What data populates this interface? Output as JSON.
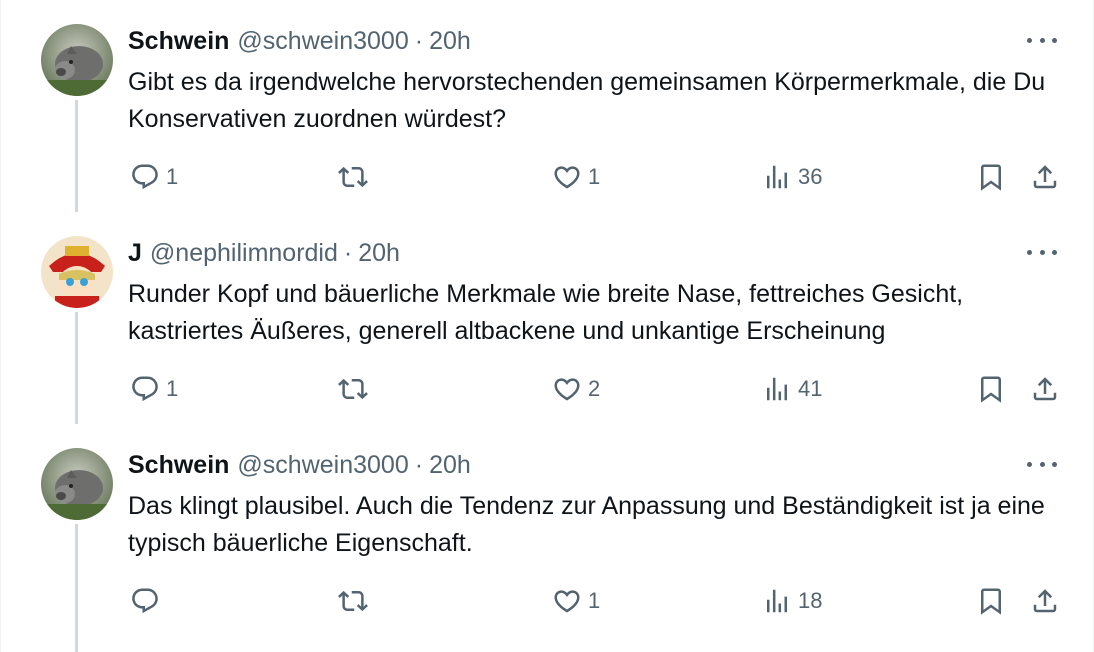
{
  "tweets": [
    {
      "name": "Schwein",
      "handle": "@schwein3000",
      "time": "20h",
      "text": "Gibt es da irgendwelche hervorstechenden gemeinsamen Körpermerkmale, die Du Konservativen zuordnen würdest?",
      "replies": "1",
      "retweets": "",
      "likes": "1",
      "views": "36",
      "avatar": "pig-avatar"
    },
    {
      "name": "J",
      "handle": "@nephilimnordid",
      "time": "20h",
      "text": "Runder Kopf und bäuerliche Merkmale wie breite Nase, fettreiches Gesicht, kastriertes Äußeres, generell altbackene und unkantige Erscheinung",
      "replies": "1",
      "retweets": "",
      "likes": "2",
      "views": "41",
      "avatar": "anime-avatar"
    },
    {
      "name": "Schwein",
      "handle": "@schwein3000",
      "time": "20h",
      "text": "Das klingt plausibel. Auch die Tendenz zur Anpassung und Beständigkeit ist ja eine typisch bäuerliche Eigenschaft.",
      "replies": "",
      "retweets": "",
      "likes": "1",
      "views": "18",
      "avatar": "pig-avatar"
    }
  ],
  "separator": "·",
  "colors": {
    "text": "#0f1419",
    "secondary": "#536471",
    "thread_line": "#cfd9de"
  }
}
